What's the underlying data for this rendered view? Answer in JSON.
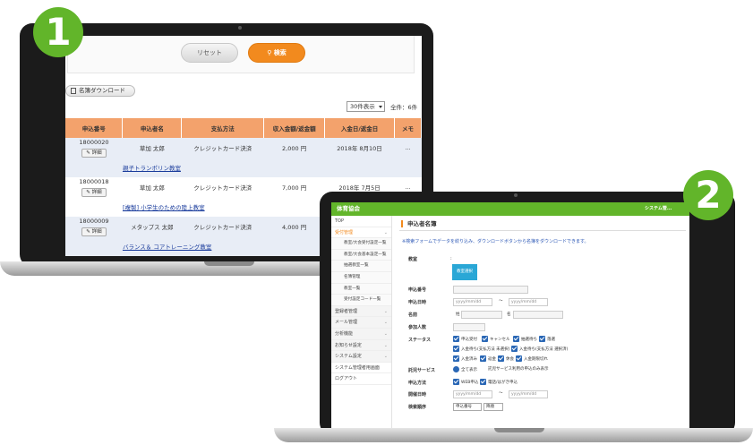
{
  "badges": {
    "one": "1",
    "two": "2"
  },
  "screen1": {
    "reset_label": "リセット",
    "search_label": "検索",
    "download_label": "名簿ダウンロード",
    "per_page": "30件表示",
    "total": "全件：6件",
    "columns": [
      "申込番号",
      "申込者名",
      "支払方法",
      "収入金額/返金額",
      "入金日/返金日",
      "メモ"
    ],
    "detail_label": "詳細",
    "rows": [
      {
        "id": "18000020",
        "name": "草加 太郎",
        "pay": "クレジットカード決済",
        "amount": "2,000 円",
        "date": "2018年 8月10日",
        "memo": "...",
        "course": "親子トランポリン教室"
      },
      {
        "id": "18000018",
        "name": "草加 太郎",
        "pay": "クレジットカード決済",
        "amount": "7,000 円",
        "date": "2018年 7月5日",
        "memo": "...",
        "course": "[複製] 小学生のための陸上教室"
      },
      {
        "id": "18000009",
        "name": "メタップス 太郎",
        "pay": "クレジットカード決済",
        "amount": "4,000 円",
        "date": "",
        "memo": "",
        "course": "バランス＆ コアトレーニング教室"
      }
    ]
  },
  "screen2": {
    "header_title": "体育協会",
    "header_system": "システム管...",
    "sidebar": [
      {
        "label": "TOP",
        "type": "top"
      },
      {
        "label": "受付管理",
        "type": "active"
      },
      {
        "label": "教室/大会受付設定一覧",
        "type": "sub"
      },
      {
        "label": "教室/大会基本設定一覧",
        "type": "sub"
      },
      {
        "label": "抽選教室一覧",
        "type": "sub"
      },
      {
        "label": "名簿管理",
        "type": "sub"
      },
      {
        "label": "教室一覧",
        "type": "sub"
      },
      {
        "label": "受付設定コード一覧",
        "type": "sub"
      },
      {
        "label": "登録者管理",
        "type": "group"
      },
      {
        "label": "メール管理",
        "type": "group"
      },
      {
        "label": "分析機能",
        "type": "group"
      },
      {
        "label": "お知らせ設定",
        "type": "group"
      },
      {
        "label": "システム設定",
        "type": "group"
      },
      {
        "label": "システム管理者用画面",
        "type": "plain"
      },
      {
        "label": "ログアウト",
        "type": "plain"
      }
    ],
    "page_title": "申込者名簿",
    "note": "※検索フォームでデータを絞り込み、ダウンロードボタンから名簿をダウンロードできます。",
    "labels": {
      "class": "教室",
      "class_button": "教室選択",
      "app_no": "申込番号",
      "app_date": "申込日時",
      "name": "名前",
      "participants": "参加人数",
      "status": "ステータス",
      "service": "託児サービス",
      "method": "申込方法",
      "event_date": "開催日時",
      "sort": "検索順序"
    },
    "date_placeholder": "yyyy/mm/dd",
    "tilde": "〜",
    "sei": "姓",
    "mei": "名",
    "status_options": [
      "申込受付",
      "キャンセル",
      "抽選待ち",
      "落選",
      "入金待ち(支払方法 未選択)",
      "入金待ち(支払方法 選択済)",
      "入金済み",
      "返金",
      "休会",
      "入金期限切れ"
    ],
    "service_options": [
      "全て表示",
      "託児サービス利用の申込のみ表示"
    ],
    "method_options": [
      "WEB申込",
      "電話/はがき申込"
    ],
    "sort_field": "申込番号",
    "sort_order": "降順"
  }
}
